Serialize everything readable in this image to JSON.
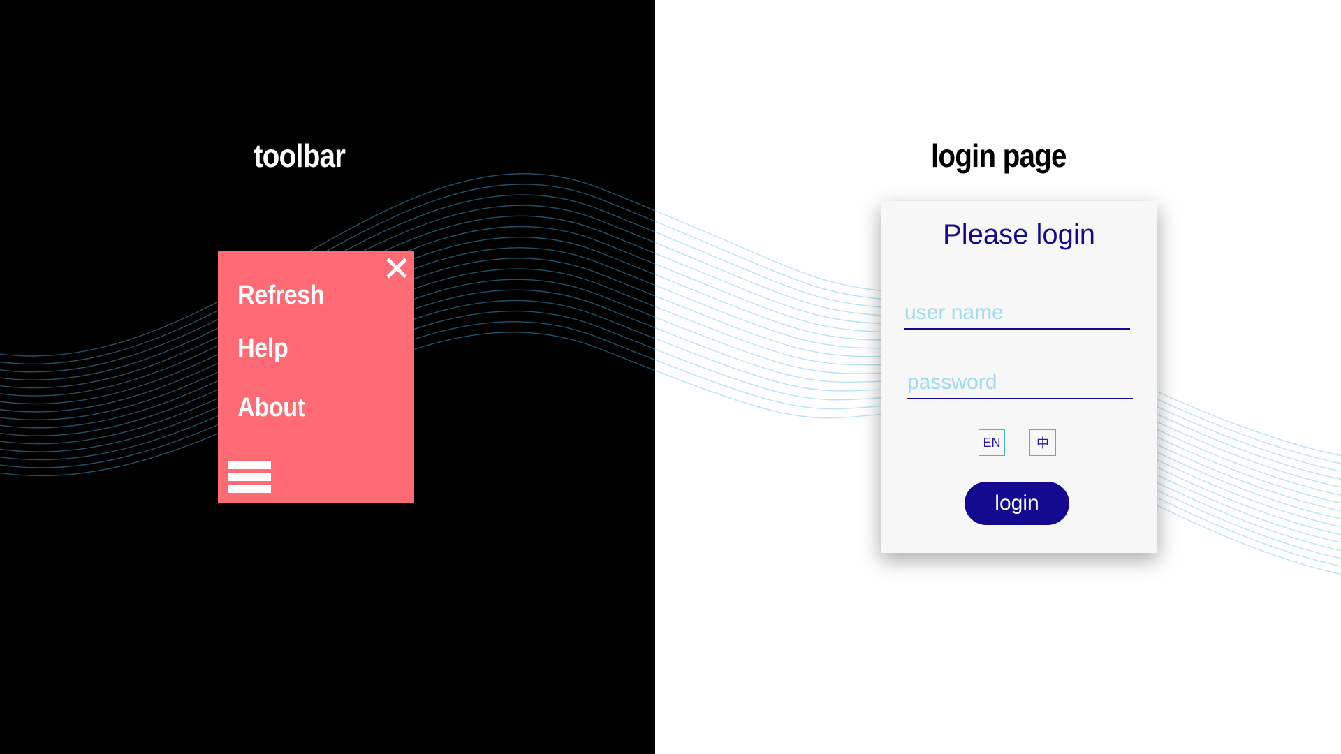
{
  "sections": {
    "toolbar_title": "toolbar",
    "login_title": "login page"
  },
  "toolbar": {
    "close_icon": "close-icon",
    "menu_icon": "hamburger-menu-icon",
    "items": [
      {
        "label": "Refresh"
      },
      {
        "label": "Help"
      },
      {
        "label": "About"
      }
    ],
    "background_color": "#ff6b75"
  },
  "login": {
    "heading": "Please login",
    "username_placeholder": "user name",
    "password_placeholder": "password",
    "languages": [
      {
        "label": "EN"
      },
      {
        "label": "中"
      }
    ],
    "submit_label": "login",
    "accent_color": "#140a8f",
    "placeholder_color": "#9fd9ee"
  }
}
